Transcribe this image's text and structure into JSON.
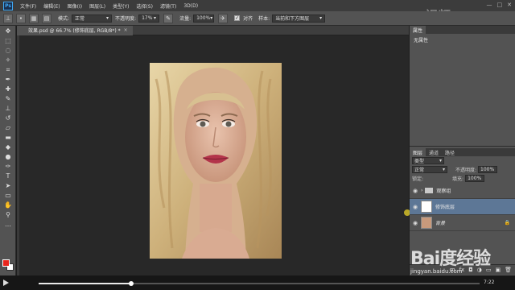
{
  "menubar": {
    "logo": "Ps",
    "items": [
      "文件(F)",
      "编辑(E)",
      "图像(I)",
      "图层(L)",
      "类型(Y)",
      "选择(S)",
      "滤镜(T)",
      "3D(D)"
    ],
    "window_buttons": [
      "—",
      "□",
      "✕"
    ]
  },
  "optionsbar": {
    "mode_label": "模式:",
    "mode_value": "正常",
    "opacity_label": "不透明度:",
    "opacity_value": "17%",
    "flow_label": "流量:",
    "flow_value": "100%",
    "aligned_label": "对齐",
    "sample_label": "样本:",
    "sample_value": "当前和下方图层"
  },
  "document": {
    "tab_title": "效果.psd @ 66.7% (修饰底层, RGB/8*) *",
    "tab_close": "×"
  },
  "properties": {
    "tab_label": "属性",
    "content": "无属性"
  },
  "layers_panel": {
    "tabs": [
      "图层",
      "通道",
      "路径"
    ],
    "filter_kind": "类型",
    "blend_mode": "正常",
    "opacity_label": "不透明度:",
    "opacity_value": "100%",
    "lock_label": "锁定:",
    "fill_label": "填充:",
    "fill_value": "100%",
    "layers": [
      {
        "name": "观察组",
        "type": "group",
        "selected": false
      },
      {
        "name": "修饰底层",
        "type": "layer",
        "selected": true
      },
      {
        "name": "背景",
        "type": "background",
        "selected": false
      }
    ],
    "bottom_icons": [
      "ꝏ",
      "fx",
      "◘",
      "◑",
      "▭",
      "▣",
      "🗑"
    ]
  },
  "video": {
    "time": "7:22",
    "progress": 0.21
  },
  "watermark": {
    "top_text": "视频",
    "brand": "Bai度经验",
    "url": "jingyan.baidu.com"
  },
  "colors": {
    "foreground": "#e8251c",
    "background": "#ffffff",
    "selected_layer": "#5d7796"
  }
}
